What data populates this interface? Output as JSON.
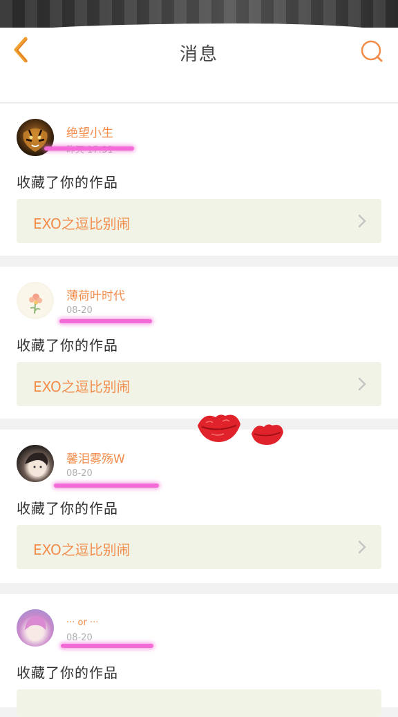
{
  "header": {
    "title": "消息",
    "back_icon": "chevron-left-icon",
    "search_icon": "search-icon",
    "accent_color": "#f0a030"
  },
  "messages": [
    {
      "name": "绝望小生",
      "time": "昨天 17:31",
      "action": "收藏了你的作品",
      "work": "EXO之逗比别闹"
    },
    {
      "name": "薄荷叶时代",
      "time": "08-20",
      "action": "收藏了你的作品",
      "work": "EXO之逗比别闹"
    },
    {
      "name": "馨泪雾殇W",
      "time": "08-20",
      "action": "收藏了你的作品",
      "work": "EXO之逗比别闹"
    },
    {
      "name": "··· or ···",
      "time": "08-20",
      "action": "收藏了你的作品",
      "work": ""
    }
  ],
  "colors": {
    "name_color": "#f28c4a",
    "work_bg": "#f1f3e7",
    "highlight": "#f36cd6",
    "lips": "#e0222a"
  }
}
